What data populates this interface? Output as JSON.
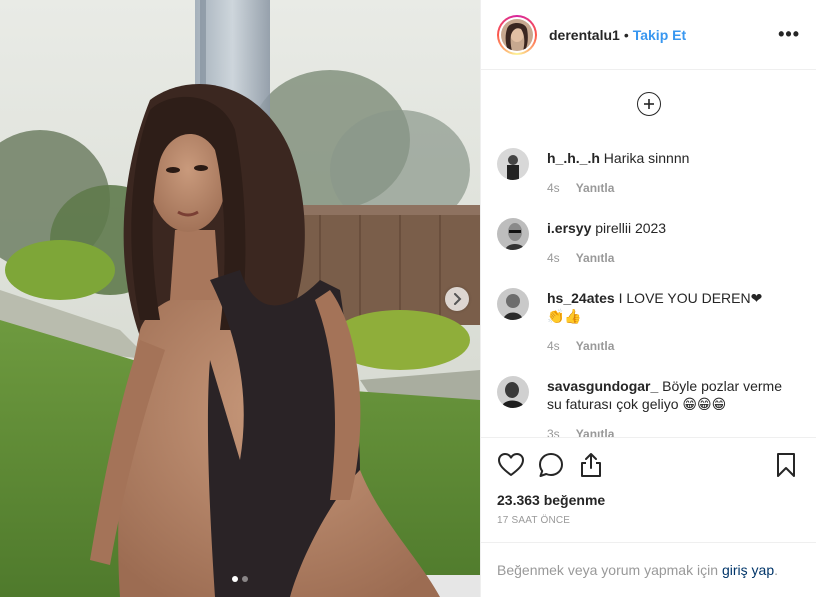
{
  "post": {
    "username": "derentalu1",
    "follow_label": "Takip Et",
    "separator": "•",
    "more_label": "•••"
  },
  "comments": [
    {
      "user": "h_.h._.h",
      "text": "Harika sinnnn",
      "time": "4s",
      "reply": "Yanıtla"
    },
    {
      "user": "i.ersyy",
      "text": "pirellii 2023",
      "time": "4s",
      "reply": "Yanıtla"
    },
    {
      "user": "hs_24ates",
      "text": "I LOVE YOU DEREN❤👏👍",
      "time": "4s",
      "reply": "Yanıtla"
    },
    {
      "user": "savasgundogar_",
      "text": "Böyle pozlar verme su faturası çok geliyo 😁😁😁",
      "time": "3s",
      "reply": "Yanıtla"
    }
  ],
  "stats": {
    "likes": "23.363 beğenme",
    "posted": "17 SAAT ÖNCE"
  },
  "footer": {
    "prompt": "Beğenmek veya yorum yapmak için",
    "login_link": "giriş yap",
    "end": "."
  },
  "carousel": {
    "total_slides": 2,
    "active_slide": 1
  },
  "colors": {
    "link": "#3897f0",
    "muted": "#999999",
    "text": "#262626",
    "login": "#003569"
  },
  "icons": [
    "plus-circle-icon",
    "heart-icon",
    "comment-icon",
    "share-icon",
    "bookmark-icon",
    "chevron-right-icon",
    "more-icon"
  ]
}
